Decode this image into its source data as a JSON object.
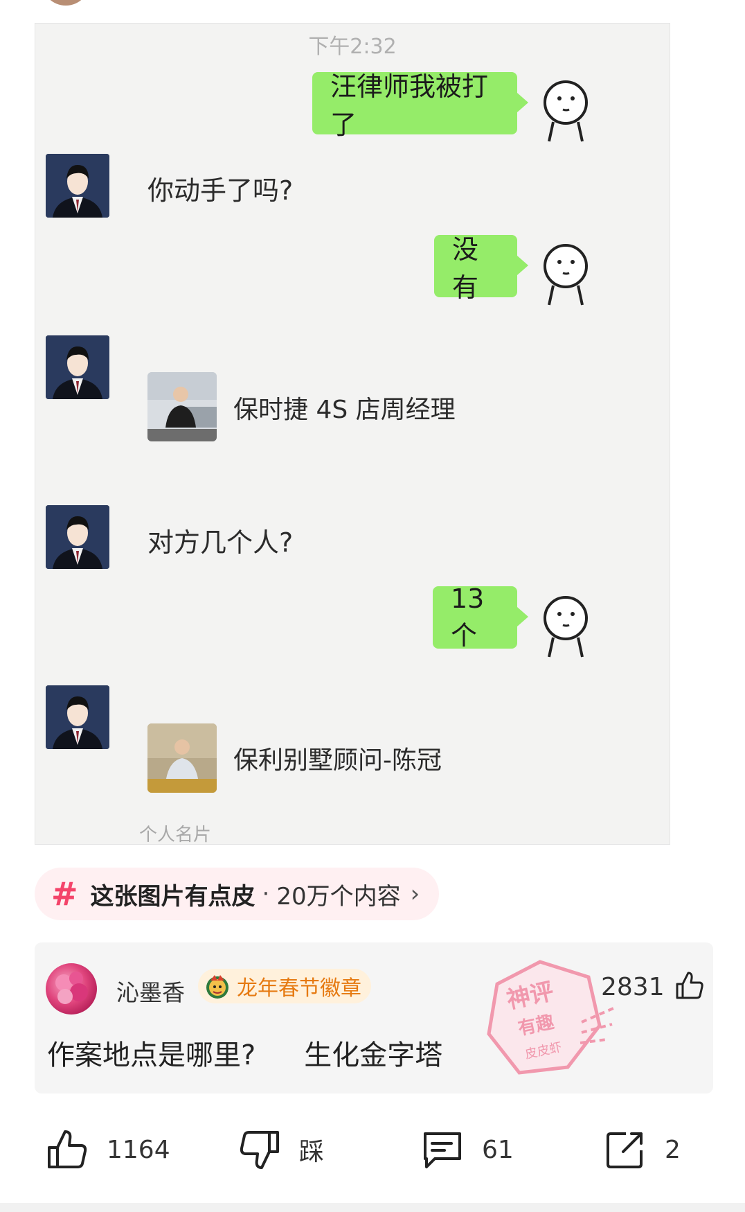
{
  "chat_screenshot": {
    "time": "下午2:32",
    "messages": [
      {
        "side": "sent",
        "text": "汪律师我被打了"
      },
      {
        "side": "received",
        "text": "你动手了吗?"
      },
      {
        "side": "sent",
        "text": "没有"
      },
      {
        "side": "received_card",
        "name": "保时捷 4S 店周经理"
      },
      {
        "side": "received",
        "text": "对方几个人?"
      },
      {
        "side": "sent",
        "text": "13个"
      },
      {
        "side": "received_card",
        "name": "保利别墅顾问-陈冠"
      }
    ],
    "card_label": "个人名片"
  },
  "topic": {
    "hash_symbol": "#",
    "title": "这张图片有点皮",
    "separator": "·",
    "count": "20万个内容",
    "chevron": "›"
  },
  "comment": {
    "username": "沁墨香",
    "badge": "龙年春节徽章",
    "likes": "2831",
    "text_part1": "作案地点是哪里?",
    "text_part2": "生化金字塔",
    "icon_like": "thumbs-up-icon"
  },
  "watermark": {
    "line1": "神评",
    "line2": "有趣",
    "line3": "皮皮虾",
    "color": "#f07a96"
  },
  "actions": {
    "like_count": "1164",
    "dislike_label": "踩",
    "comment_count": "61",
    "share_count": "2"
  },
  "colors": {
    "bubble_green": "#95ec69",
    "topic_accent": "#f4446a",
    "badge_text": "#e67a12"
  }
}
